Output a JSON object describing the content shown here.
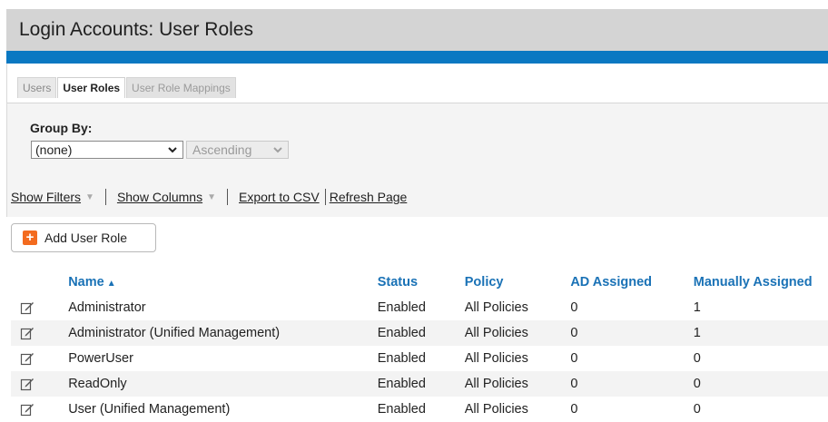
{
  "page": {
    "title": "Login Accounts: User Roles",
    "top_mark": "ˇ"
  },
  "tabs": [
    {
      "label": "Users",
      "active": false
    },
    {
      "label": "User Roles",
      "active": true
    },
    {
      "label": "User Role Mappings",
      "active": false
    }
  ],
  "panel": {
    "group_by_label": "Group By:",
    "group_by_value": "(none)",
    "sort_order_value": "Ascending",
    "links": {
      "show_filters": "Show Filters",
      "show_columns": "Show Columns",
      "export_csv": "Export to CSV",
      "refresh": "Refresh Page"
    }
  },
  "add_button": {
    "label": "Add User Role",
    "icon": "plus-icon"
  },
  "table": {
    "headers": {
      "name": "Name",
      "status": "Status",
      "policy": "Policy",
      "ad_assigned": "AD Assigned",
      "manually_assigned": "Manually Assigned"
    },
    "rows": [
      {
        "name": "Administrator",
        "status": "Enabled",
        "policy": "All Policies",
        "ad": "0",
        "manual": "1"
      },
      {
        "name": "Administrator (Unified Management)",
        "status": "Enabled",
        "policy": "All Policies",
        "ad": "0",
        "manual": "1"
      },
      {
        "name": "PowerUser",
        "status": "Enabled",
        "policy": "All Policies",
        "ad": "0",
        "manual": "0"
      },
      {
        "name": "ReadOnly",
        "status": "Enabled",
        "policy": "All Policies",
        "ad": "0",
        "manual": "0"
      },
      {
        "name": "User (Unified Management)",
        "status": "Enabled",
        "policy": "All Policies",
        "ad": "0",
        "manual": "0"
      }
    ]
  },
  "colors": {
    "header_blue": "#0a78c2",
    "link_blue": "#1a72b6",
    "add_orange": "#f36b1f",
    "title_bg": "#d4d4d4"
  }
}
